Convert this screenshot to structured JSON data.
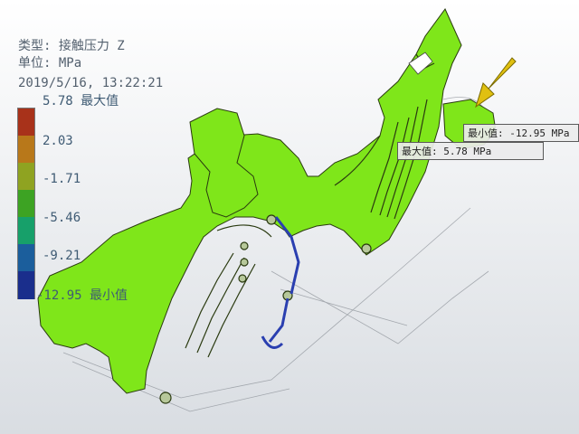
{
  "header": {
    "type_line": "类型: 接触压力 Z",
    "unit_line": "单位: MPa",
    "timestamp": "2019/5/16, 13:22:21"
  },
  "legend": {
    "max_label": "5.78 最大值",
    "ticks": [
      "2.03",
      "-1.71",
      "-5.46",
      "-9.21"
    ],
    "min_label": "-12.95 最小值",
    "colors": [
      "#a8321a",
      "#b8781a",
      "#8fa321",
      "#3da323",
      "#17a06a",
      "#1b5e9c",
      "#1a2e8c"
    ]
  },
  "callouts": {
    "min": "最小值: -12.95 MPa",
    "max": "最大值: 5.78 MPa"
  },
  "model": {
    "body_color": "#7fe61a",
    "edge_color": "#2a3a10",
    "link_color": "#2a3fb0",
    "arrow_color": "#e0c010"
  }
}
